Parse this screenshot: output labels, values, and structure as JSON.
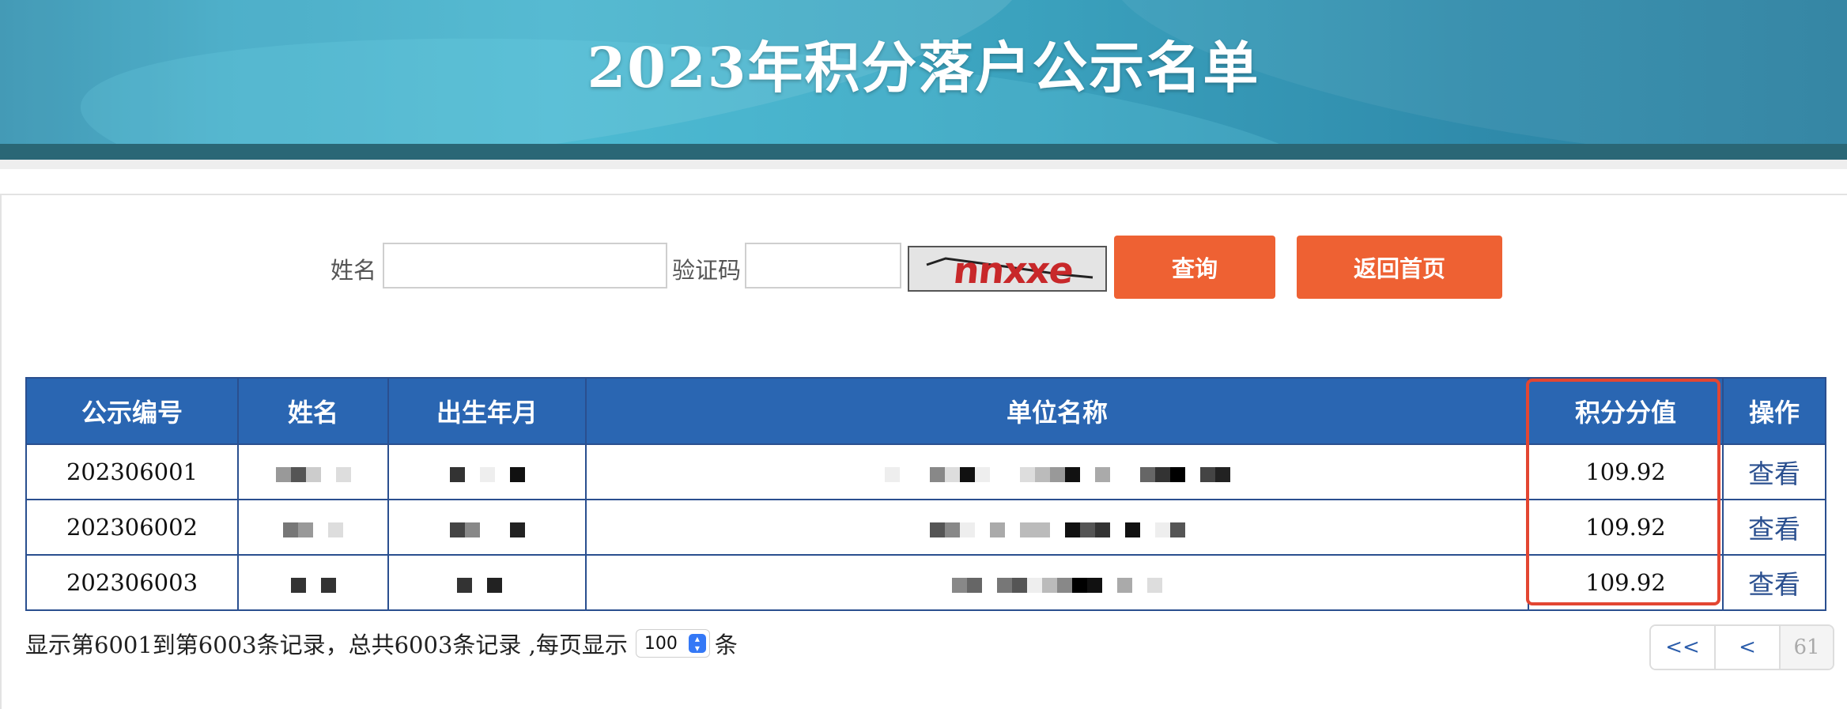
{
  "header": {
    "title": "2023年积分落户公示名单"
  },
  "search": {
    "name_label": "姓名",
    "captcha_label": "验证码",
    "name_value": "",
    "captcha_value": "",
    "captcha_text": "nnxxe",
    "query_button": "查询",
    "home_button": "返回首页"
  },
  "table": {
    "columns": [
      "公示编号",
      "姓名",
      "出生年月",
      "单位名称",
      "积分分值",
      "操作"
    ],
    "rows": [
      {
        "id": "202306001",
        "score": "109.92",
        "action": "查看"
      },
      {
        "id": "202306002",
        "score": "109.92",
        "action": "查看"
      },
      {
        "id": "202306003",
        "score": "109.92",
        "action": "查看"
      }
    ]
  },
  "footer": {
    "summary": "显示第6001到第6003条记录，总共6003条记录 ,每页显示",
    "page_size": "100",
    "unit": "条"
  },
  "pagination": {
    "first": "<<",
    "prev": "<",
    "current": "61"
  },
  "colors": {
    "header_bg": "#2a66b2",
    "button_bg": "#ee6133",
    "highlight": "#e34632"
  }
}
